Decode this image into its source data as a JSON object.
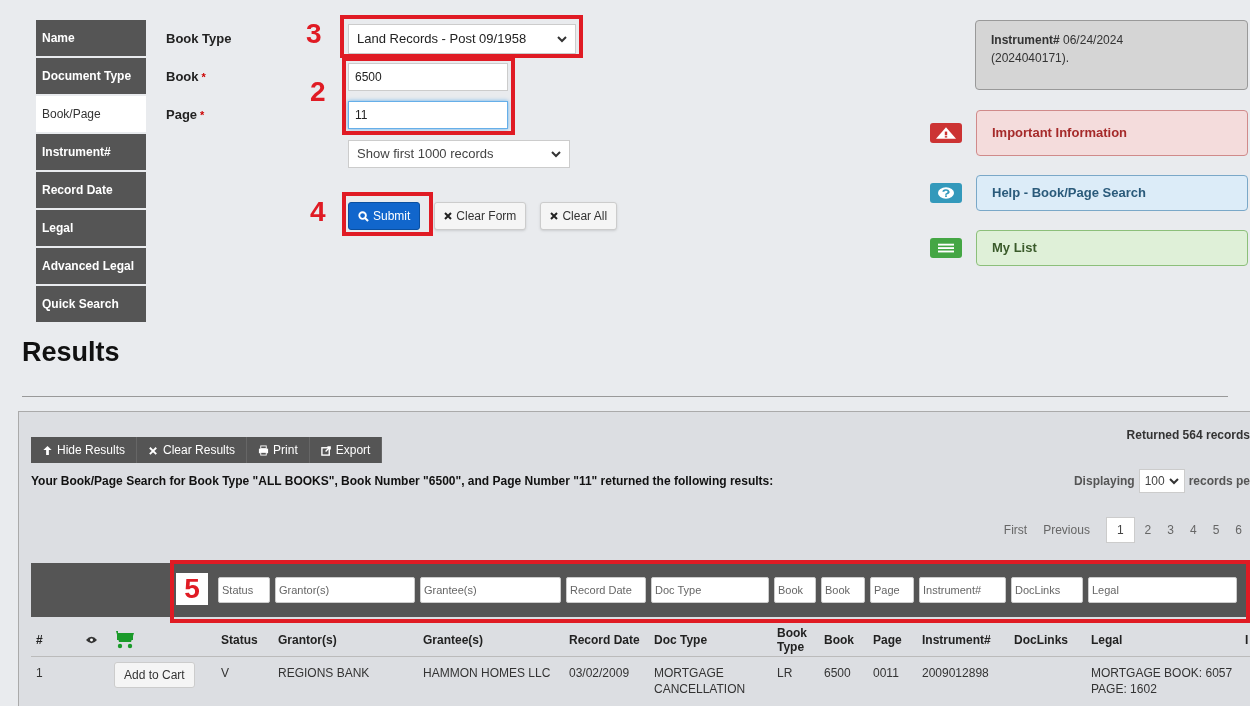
{
  "nav": [
    {
      "label": "Name",
      "selected": false
    },
    {
      "label": "Document Type",
      "selected": false
    },
    {
      "label": "Book/Page",
      "selected": true
    },
    {
      "label": "Instrument#",
      "selected": false
    },
    {
      "label": "Record Date",
      "selected": false
    },
    {
      "label": "Legal",
      "selected": false
    },
    {
      "label": "Advanced Legal",
      "selected": false
    },
    {
      "label": "Quick Search",
      "selected": false
    }
  ],
  "form": {
    "book_type": {
      "label": "Book Type",
      "value": "Land Records - Post 09/1958"
    },
    "book": {
      "label": "Book",
      "required_mark": "*",
      "value": "6500",
      "focused": false
    },
    "page": {
      "label": "Page",
      "required_mark": "*",
      "value": "11",
      "focused": true
    },
    "limit": {
      "value": "Show first 1000 records"
    },
    "buttons": [
      {
        "kind": "primary",
        "label": "Submit"
      },
      {
        "kind": "default",
        "label": "Clear Form"
      },
      {
        "kind": "default",
        "label": "Clear All"
      }
    ]
  },
  "notice": "**Instrument#** 06/24/2024 (2024040171).",
  "info_panels": [
    {
      "kind": "danger",
      "label": "Important Information"
    },
    {
      "kind": "info",
      "label": "Help - Book/Page Search"
    },
    {
      "kind": "success",
      "label": "My List"
    }
  ],
  "results": {
    "heading": "Results",
    "toolbar": [
      {
        "kind": "hide",
        "label": "Hide Results"
      },
      {
        "kind": "clear",
        "label": "Clear Results"
      },
      {
        "kind": "print",
        "label": "Print"
      },
      {
        "kind": "export",
        "label": "Export"
      }
    ],
    "returned": "Returned 564 records",
    "summary": "Your Book/Page Search for Book Type \"ALL BOOKS\", Book Number \"6500\", and Page Number \"11\" returned the following results:",
    "displaying": {
      "label": "Displaying",
      "value": "100",
      "suffix": "records pe"
    },
    "pagination": [
      {
        "label": "First",
        "selected": false
      },
      {
        "label": "Previous",
        "selected": false
      },
      {
        "label": "1",
        "selected": true
      },
      {
        "label": "2",
        "selected": false
      },
      {
        "label": "3",
        "selected": false
      },
      {
        "label": "4",
        "selected": false
      },
      {
        "label": "5",
        "selected": false
      },
      {
        "label": "6",
        "selected": false
      }
    ],
    "filters": [
      {
        "placeholder": "Status"
      },
      {
        "placeholder": "Grantor(s)"
      },
      {
        "placeholder": "Grantee(s)"
      },
      {
        "placeholder": "Record Date"
      },
      {
        "placeholder": "Doc Type"
      },
      {
        "placeholder": "Book"
      },
      {
        "placeholder": "Book"
      },
      {
        "placeholder": "Page"
      },
      {
        "placeholder": "Instrument#"
      },
      {
        "placeholder": "DocLinks"
      },
      {
        "placeholder": "Legal"
      }
    ],
    "columns": [
      "#",
      "Status",
      "Grantor(s)",
      "Grantee(s)",
      "Record Date",
      "Doc Type",
      "Book Type",
      "Book",
      "Page",
      "Instrument#",
      "DocLinks",
      "Legal",
      "I"
    ],
    "rows": [
      {
        "number": "1",
        "action": "Add to Cart",
        "status": "V",
        "grantor": "REGIONS BANK",
        "grantee": "HAMMON HOMES LLC",
        "record_date": "03/02/2009",
        "doc_type": "MORTGAGE CANCELLATION",
        "book_type": "LR",
        "book": "6500",
        "page": "0011",
        "instrument": "2009012898",
        "legal": "MORTGAGE BOOK: 6057 PAGE: 1602"
      }
    ]
  },
  "annotations": [
    {
      "label": "3"
    },
    {
      "label": "2"
    },
    {
      "label": "4"
    },
    {
      "label": "5"
    }
  ]
}
